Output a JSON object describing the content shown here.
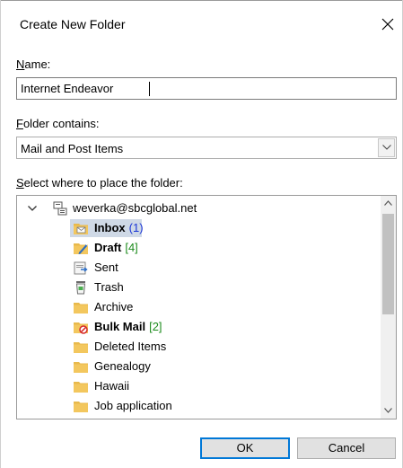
{
  "dialog": {
    "title": "Create New Folder",
    "close_glyph": "close-icon"
  },
  "name_field": {
    "label_hotkey": "N",
    "label_rest": "ame:",
    "value": "Internet Endeavor"
  },
  "folder_contains": {
    "label_hotkey": "F",
    "label_rest": "older contains:",
    "selected": "Mail and Post Items"
  },
  "placement": {
    "label_hotkey": "S",
    "label_rest": "elect where to place the folder:"
  },
  "tree": {
    "account": "weverka@sbcglobal.net",
    "folders": [
      {
        "name": "Inbox",
        "count": "(1)",
        "count_color": "#1a35d6",
        "bold": true,
        "icon": "inbox-folder-icon",
        "selected": true
      },
      {
        "name": "Draft",
        "count": "[4]",
        "count_color": "#1e8c1e",
        "bold": true,
        "icon": "drafts-folder-icon",
        "selected": false
      },
      {
        "name": "Sent",
        "count": "",
        "count_color": "",
        "bold": false,
        "icon": "sent-folder-icon",
        "selected": false
      },
      {
        "name": "Trash",
        "count": "",
        "count_color": "",
        "bold": false,
        "icon": "trash-icon",
        "selected": false
      },
      {
        "name": "Archive",
        "count": "",
        "count_color": "",
        "bold": false,
        "icon": "folder-icon",
        "selected": false
      },
      {
        "name": "Bulk Mail",
        "count": "[2]",
        "count_color": "#1e8c1e",
        "bold": true,
        "icon": "junk-folder-icon",
        "selected": false
      },
      {
        "name": "Deleted Items",
        "count": "",
        "count_color": "",
        "bold": false,
        "icon": "folder-icon",
        "selected": false
      },
      {
        "name": "Genealogy",
        "count": "",
        "count_color": "",
        "bold": false,
        "icon": "folder-icon",
        "selected": false
      },
      {
        "name": "Hawaii",
        "count": "",
        "count_color": "",
        "bold": false,
        "icon": "folder-icon",
        "selected": false
      },
      {
        "name": "Job application",
        "count": "",
        "count_color": "",
        "bold": false,
        "icon": "folder-icon",
        "selected": false
      }
    ]
  },
  "buttons": {
    "ok": "OK",
    "cancel": "Cancel"
  },
  "colors": {
    "folder_yellow": "#e8b94c",
    "selection": "#cfd9e6",
    "default_button_border": "#0078d7"
  }
}
